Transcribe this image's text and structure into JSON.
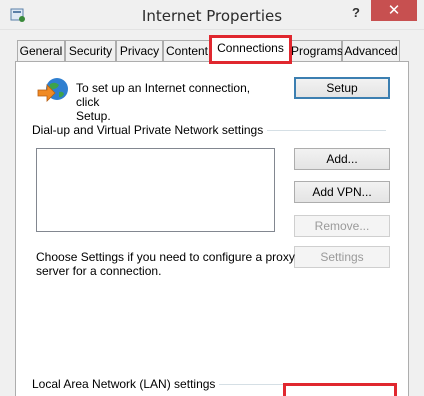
{
  "window": {
    "title": "Internet Properties",
    "help_label": "?",
    "close_label": "✕"
  },
  "tabs": [
    {
      "label": "General"
    },
    {
      "label": "Security"
    },
    {
      "label": "Privacy"
    },
    {
      "label": "Content"
    },
    {
      "label": "Connections",
      "active": true
    },
    {
      "label": "Programs"
    },
    {
      "label": "Advanced"
    }
  ],
  "setup": {
    "text_line1": "To set up an Internet connection, click",
    "text_line2": "Setup.",
    "button": "Setup"
  },
  "dialup": {
    "group_title": "Dial-up and Virtual Private Network settings",
    "add_button": "Add...",
    "add_vpn_button": "Add VPN...",
    "remove_button": "Remove...",
    "settings_button": "Settings",
    "proxy_text_line1": "Choose Settings if you need to configure a proxy",
    "proxy_text_line2": "server for a connection."
  },
  "lan": {
    "group_title": "Local Area Network (LAN) settings"
  },
  "colors": {
    "highlight": "#e0272f",
    "close_button": "#c75050"
  }
}
